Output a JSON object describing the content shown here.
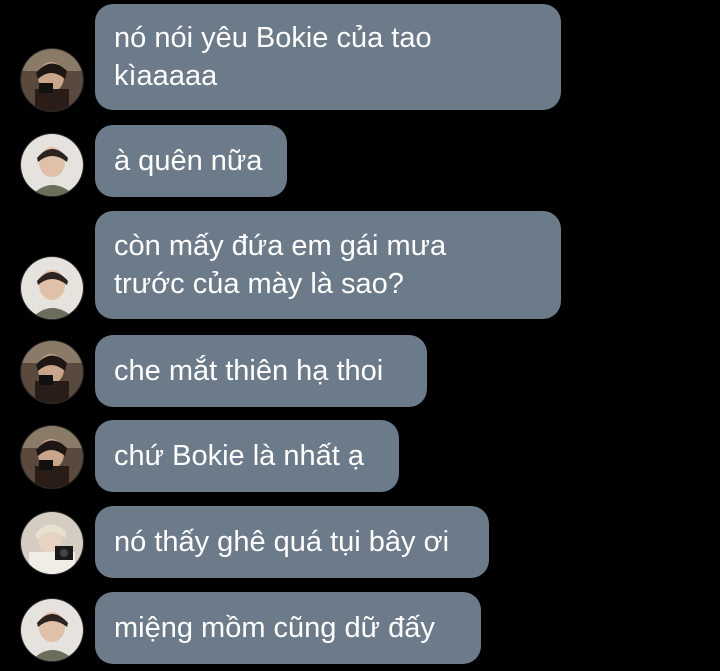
{
  "messages": [
    {
      "lines": [
        "nó nói yêu Bokie của tao",
        "kìaaaaa"
      ],
      "avatar": "avatar-dark-hair-camera",
      "accent": "#3a2a22"
    },
    {
      "lines": [
        "à quên nữa"
      ],
      "avatar": "avatar-light-smiling",
      "accent": "#e8e2dc"
    },
    {
      "lines": [
        "còn mấy đứa em gái mưa",
        "trước của mày là sao?"
      ],
      "avatar": "avatar-light-smiling",
      "accent": "#e8e2dc"
    },
    {
      "lines": [
        "che mắt thiên hạ thoi"
      ],
      "avatar": "avatar-dark-hair-camera",
      "accent": "#3a2a22"
    },
    {
      "lines": [
        "chứ Bokie là nhất ạ"
      ],
      "avatar": "avatar-dark-hair-camera",
      "accent": "#3a2a22"
    },
    {
      "lines": [
        "nó thấy ghê quá tụi bây ơi"
      ],
      "avatar": "avatar-blond-camera",
      "accent": "#d8cfc4"
    },
    {
      "lines": [
        "miệng mồm cũng dữ đấy"
      ],
      "avatar": "avatar-light-smiling",
      "accent": "#e8e2dc"
    }
  ],
  "colors": {
    "background": "#000000",
    "bubble": "#6b7b89",
    "text": "#ffffff"
  }
}
